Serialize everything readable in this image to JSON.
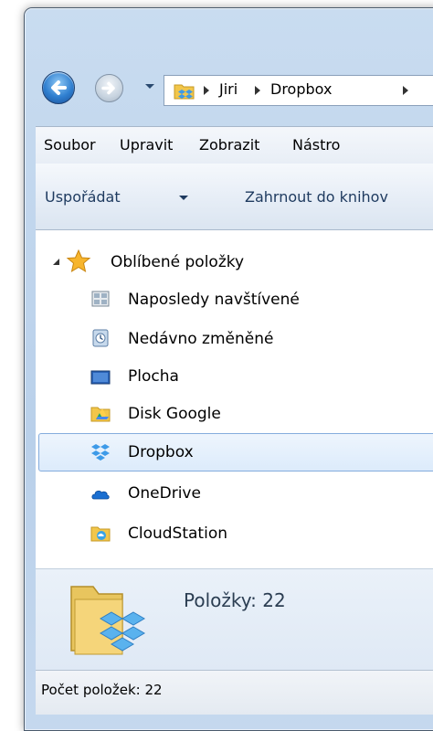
{
  "window": {
    "breadcrumb": [
      "Jiri",
      "Dropbox"
    ]
  },
  "menubar": {
    "items": [
      "Soubor",
      "Upravit",
      "Zobrazit",
      "Nástro"
    ]
  },
  "commandbar": {
    "organize_label": "Uspořádat",
    "include_label": "Zahrnout do knihov"
  },
  "navigation": {
    "favorites_label": "Oblíbené položky",
    "items": [
      {
        "label": "Naposledy navštívené",
        "icon": "recent-places-icon"
      },
      {
        "label": "Nedávno změněné",
        "icon": "recently-changed-icon"
      },
      {
        "label": "Plocha",
        "icon": "desktop-icon"
      },
      {
        "label": "Disk Google",
        "icon": "google-drive-icon"
      },
      {
        "label": "Dropbox",
        "icon": "dropbox-icon",
        "selected": true
      },
      {
        "label": "OneDrive",
        "icon": "onedrive-icon"
      },
      {
        "label": "CloudStation",
        "icon": "cloudstation-icon"
      }
    ]
  },
  "details": {
    "items_label": "Položky: 22"
  },
  "statusbar": {
    "count_label": "Počet položek: 22"
  },
  "colors": {
    "selection": "#dcebfb",
    "selection_border": "#84acdd",
    "frame": "#b9d0ea",
    "dropbox_blue": "#3d9ae8"
  }
}
